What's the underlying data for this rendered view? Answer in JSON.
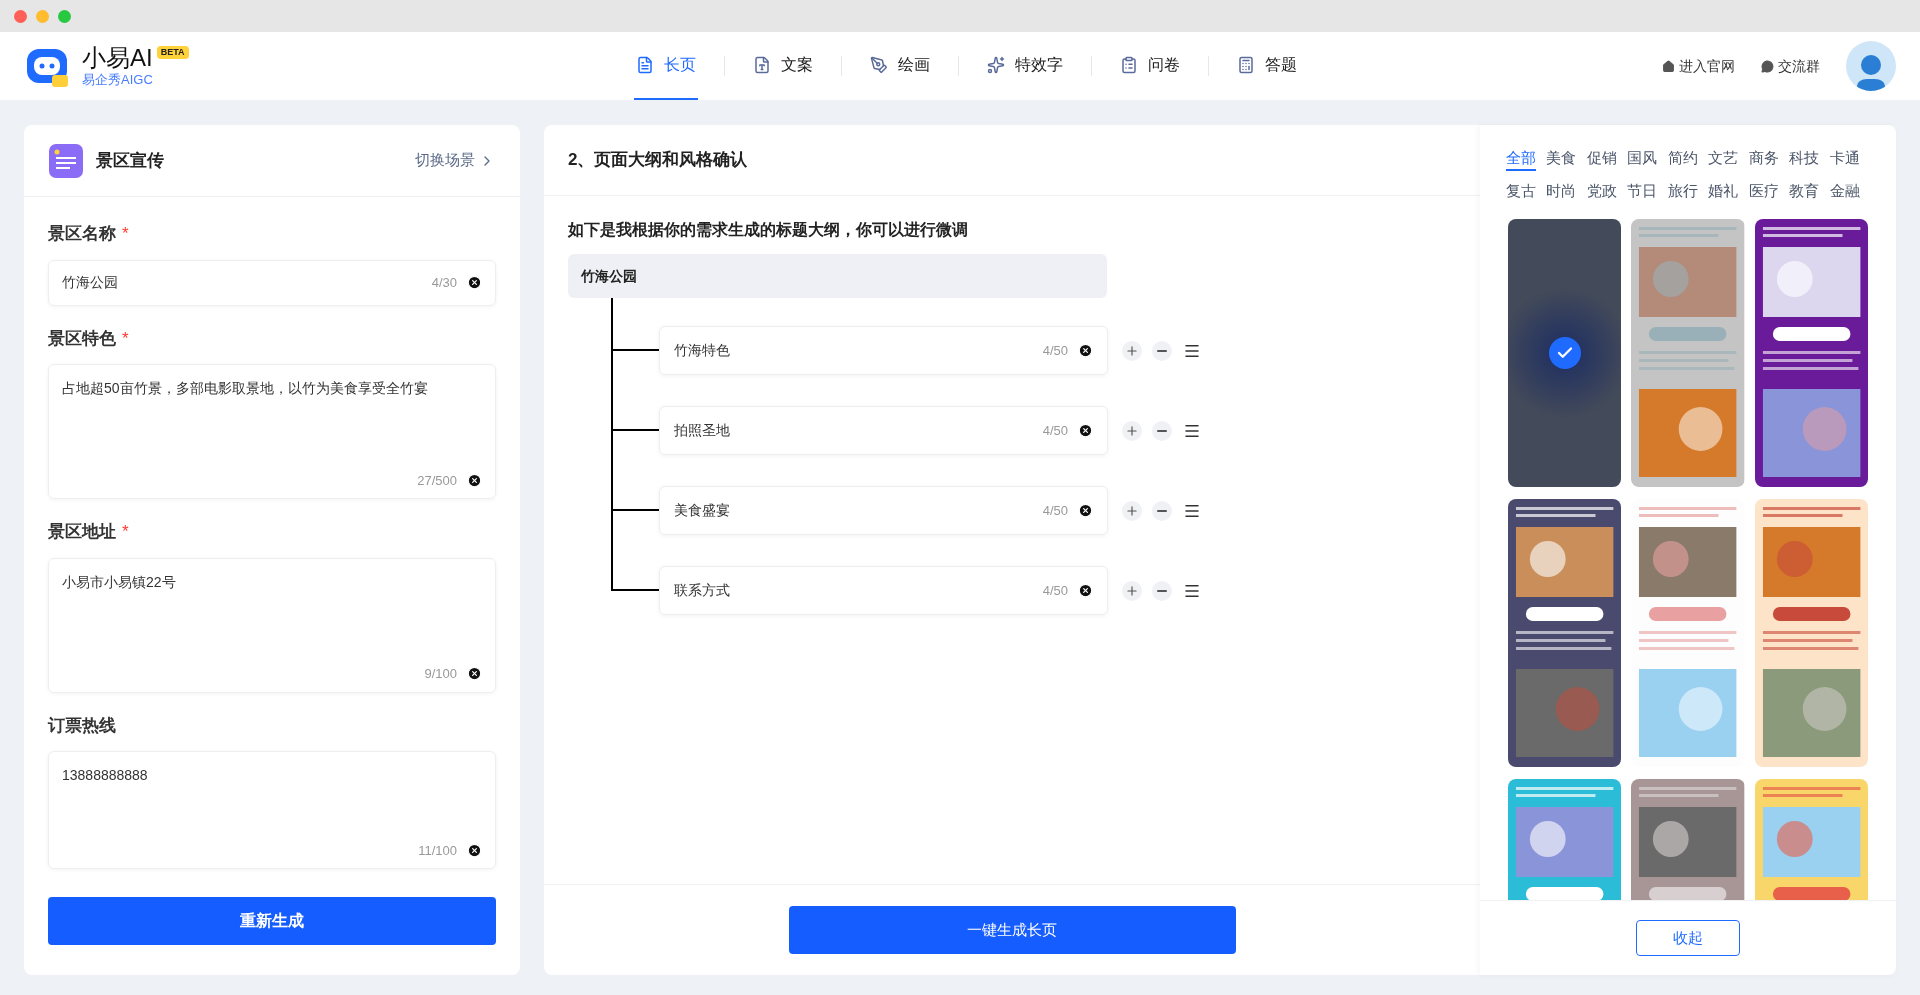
{
  "app": {
    "name": "小易AI",
    "badge": "BETA",
    "subtitle": "易企秀AIGC"
  },
  "nav": [
    {
      "label": "长页",
      "selected": true
    },
    {
      "label": "文案",
      "selected": false
    },
    {
      "label": "绘画",
      "selected": false
    },
    {
      "label": "特效字",
      "selected": false
    },
    {
      "label": "问卷",
      "selected": false
    },
    {
      "label": "答题",
      "selected": false
    }
  ],
  "header_links": [
    "进入官网",
    "交流群"
  ],
  "scene": {
    "title": "景区宣传",
    "switch_link": "切换场景"
  },
  "fields": [
    {
      "kind": "input",
      "label": "景区名称",
      "required_mark": "*",
      "value": "竹海公园",
      "count": "4/30"
    },
    {
      "kind": "textarea",
      "label": "景区特色",
      "required_mark": "*",
      "value": "占地超50亩竹景，多部电影取景地，以竹为美食享受全竹宴",
      "count": "27/500"
    },
    {
      "kind": "textarea",
      "label": "景区地址",
      "required_mark": "*",
      "value": "小易市小易镇22号",
      "count": "9/100"
    },
    {
      "kind": "textarea",
      "label": "订票热线",
      "value": "13888888888",
      "count": "11/100"
    }
  ],
  "regenerate_button": "重新生成",
  "outline": {
    "step_title": "2、页面大纲和风格确认",
    "intro": "如下是我根据你的需求生成的标题大纲，你可以进行微调",
    "root": "竹海公园",
    "children": [
      {
        "value": "竹海特色",
        "count": "4/50"
      },
      {
        "value": "拍照圣地",
        "count": "4/50"
      },
      {
        "value": "美食盛宴",
        "count": "4/50"
      },
      {
        "value": "联系方式",
        "count": "4/50"
      }
    ]
  },
  "generate_button": "一键生成长页",
  "styles": {
    "categories": [
      {
        "label": "全部",
        "selected": true
      },
      {
        "label": "美食",
        "selected": false
      },
      {
        "label": "促销",
        "selected": false
      },
      {
        "label": "国风",
        "selected": false
      },
      {
        "label": "简约",
        "selected": false
      },
      {
        "label": "文艺",
        "selected": false
      },
      {
        "label": "商务",
        "selected": false
      },
      {
        "label": "科技",
        "selected": false
      },
      {
        "label": "卡通",
        "selected": false
      },
      {
        "label": "复古",
        "selected": false
      },
      {
        "label": "时尚",
        "selected": false
      },
      {
        "label": "党政",
        "selected": false
      },
      {
        "label": "节日",
        "selected": false
      },
      {
        "label": "旅行",
        "selected": false
      },
      {
        "label": "婚礼",
        "selected": false
      },
      {
        "label": "医疗",
        "selected": false
      },
      {
        "label": "教育",
        "selected": false
      },
      {
        "label": "金融",
        "selected": false
      }
    ],
    "templates": [
      {
        "selected": true
      },
      {
        "selected": false
      },
      {
        "selected": false
      },
      {
        "selected": false
      },
      {
        "selected": false
      },
      {
        "selected": false
      },
      {
        "selected": false
      },
      {
        "selected": false
      },
      {
        "selected": false
      }
    ],
    "collapse_button": "收起"
  }
}
